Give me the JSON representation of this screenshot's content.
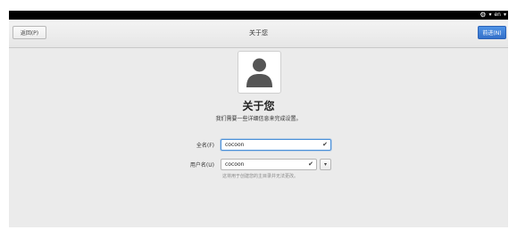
{
  "topbar": {
    "keyboard_indicator": "en",
    "menu_arrow": "▾",
    "gear_arrow": "▾"
  },
  "header": {
    "back_label": "返回(P)",
    "title": "关于您",
    "next_label": "前进(N)"
  },
  "main": {
    "title": "关于您",
    "subtitle": "我们需要一些详细信息来完成设置。",
    "fullname": {
      "label": "全名(F)",
      "value": "cocoon"
    },
    "username": {
      "label": "用户名(U)",
      "value": "cocoon",
      "hint": "这将用于创建您的主目录并无法更改。"
    }
  },
  "colors": {
    "accent": "#3a78d0",
    "background": "#ebebeb",
    "topbar": "#000000"
  }
}
